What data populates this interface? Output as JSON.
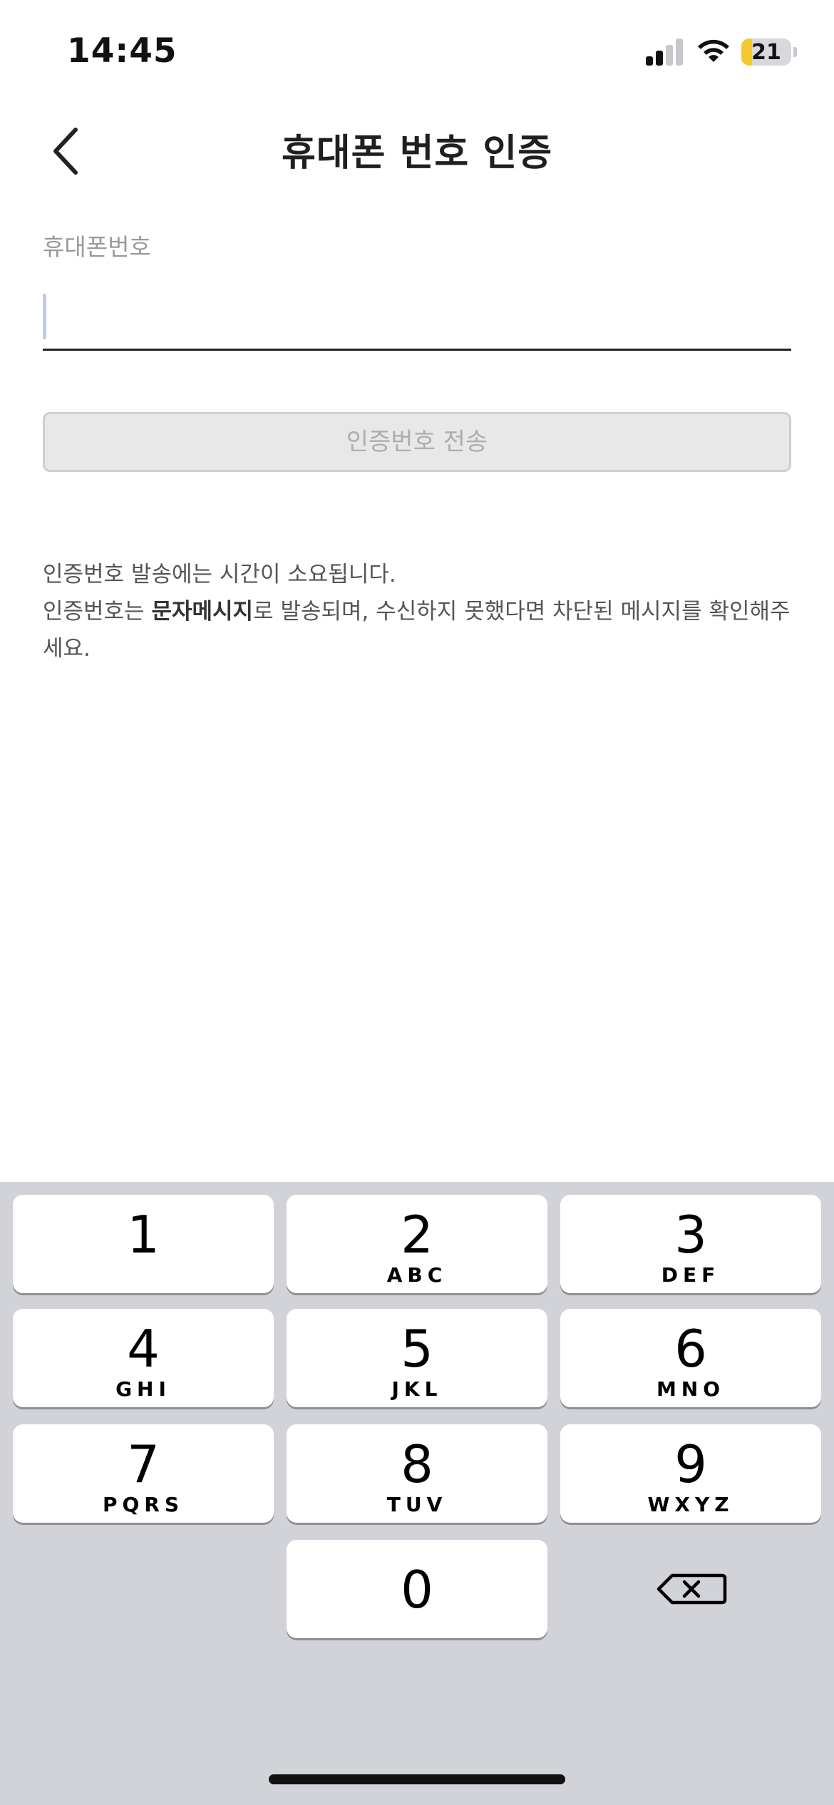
{
  "status_bar": {
    "time": "14:45",
    "signal_icon": "cellular-signal-icon",
    "signal_bars_active": 2,
    "signal_bars_total": 4,
    "wifi_icon": "wifi-icon",
    "battery_level": "21",
    "battery_fraction": 0.21,
    "battery_color": "#f4c931"
  },
  "header": {
    "back_icon": "chevron-left-icon",
    "title": "휴대폰 번호 인증"
  },
  "form": {
    "phone_label": "휴대폰번호",
    "phone_value": "",
    "phone_placeholder": "",
    "send_button_label": "인증번호 전송",
    "send_button_enabled": false
  },
  "info": {
    "line1": "인증번호 발송에는 시간이 소요됩니다.",
    "line2_prefix": "인증번호는 ",
    "line2_bold": "문자메시지",
    "line2_suffix": "로 발송되며, 수신하지 못했다면 차단된 메시지를 확인해주세요."
  },
  "keypad": {
    "keys": [
      {
        "digit": "1",
        "letters": ""
      },
      {
        "digit": "2",
        "letters": "ABC"
      },
      {
        "digit": "3",
        "letters": "DEF"
      },
      {
        "digit": "4",
        "letters": "GHI"
      },
      {
        "digit": "5",
        "letters": "JKL"
      },
      {
        "digit": "6",
        "letters": "MNO"
      },
      {
        "digit": "7",
        "letters": "PQRS"
      },
      {
        "digit": "8",
        "letters": "TUV"
      },
      {
        "digit": "9",
        "letters": "WXYZ"
      },
      {
        "digit": "0",
        "letters": ""
      }
    ],
    "delete_icon": "backspace-icon"
  },
  "colors": {
    "keyboard_background": "#d1d3d9",
    "key_background": "#ffffff",
    "disabled_button": "#e8e8e8",
    "caret": "#c5cae9"
  }
}
